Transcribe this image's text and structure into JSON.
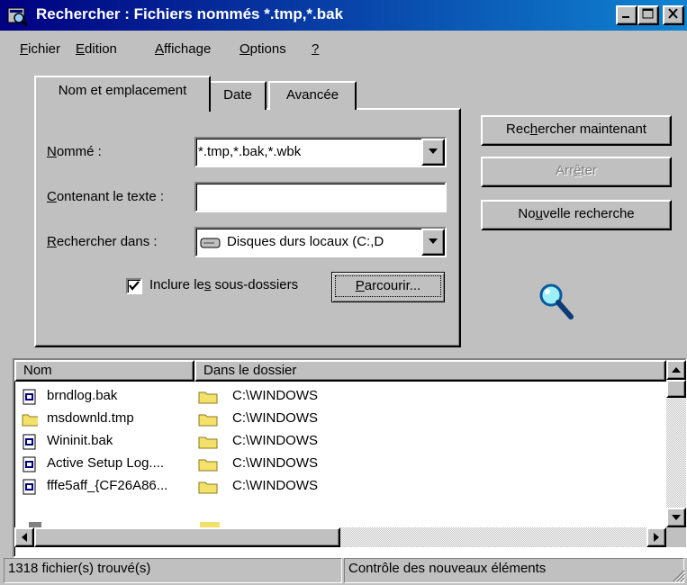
{
  "window": {
    "title": "Rechercher : Fichiers nommés *.tmp,*.bak"
  },
  "menu": [
    {
      "pre": "",
      "key": "F",
      "post": "ichier"
    },
    {
      "pre": "",
      "key": "E",
      "post": "dition"
    },
    {
      "pre": "",
      "key": "A",
      "post": "ffichage"
    },
    {
      "pre": "",
      "key": "O",
      "post": "ptions"
    },
    {
      "pre": "",
      "key": "?",
      "post": ""
    }
  ],
  "tabs": [
    "Nom et emplacement",
    "Date",
    "Avancée"
  ],
  "form": {
    "named_label": {
      "key": "N",
      "rest": "ommé :"
    },
    "named_value": "*.tmp,*.bak,*.wbk",
    "contains_label": {
      "key": "C",
      "rest": "ontenant le texte :"
    },
    "contains_value": "",
    "lookin_label": {
      "key": "R",
      "rest": "echercher dans :"
    },
    "lookin_value": "Disques durs locaux (C:,D",
    "subfolders_label": {
      "pre": "Inclure le",
      "key": "s",
      "post": " sous-dossiers"
    },
    "subfolders_checked": true,
    "browse": {
      "key": "P",
      "rest": "arcourir..."
    }
  },
  "buttons": {
    "search_now": {
      "pre": "Rec",
      "key": "h",
      "post": "ercher maintenant"
    },
    "stop": {
      "pre": "Arr",
      "key": "ê",
      "post": "ter"
    },
    "new_search": {
      "pre": "No",
      "key": "u",
      "post": "velle recherche"
    }
  },
  "list": {
    "columns": [
      "Nom",
      "Dans le dossier"
    ],
    "rows": [
      {
        "name": "brndlog.bak",
        "folder": "C:\\WINDOWS",
        "icon": "notepad-file-icon"
      },
      {
        "name": "msdownld.tmp",
        "folder": "C:\\WINDOWS",
        "icon": "folder-icon"
      },
      {
        "name": "Wininit.bak",
        "folder": "C:\\WINDOWS",
        "icon": "notepad-file-icon"
      },
      {
        "name": "Active Setup Log....",
        "folder": "C:\\WINDOWS",
        "icon": "notepad-file-icon"
      },
      {
        "name": "fffe5aff_{CF26A86...",
        "folder": "C:\\WINDOWS",
        "icon": "notepad-file-icon"
      }
    ]
  },
  "status": {
    "count": "1318 fichier(s) trouvé(s)",
    "message": "Contrôle des nouveaux éléments"
  },
  "colors": {
    "titlebar": "#000080",
    "face": "#c0c0c0",
    "folder": "#f4e16a"
  }
}
